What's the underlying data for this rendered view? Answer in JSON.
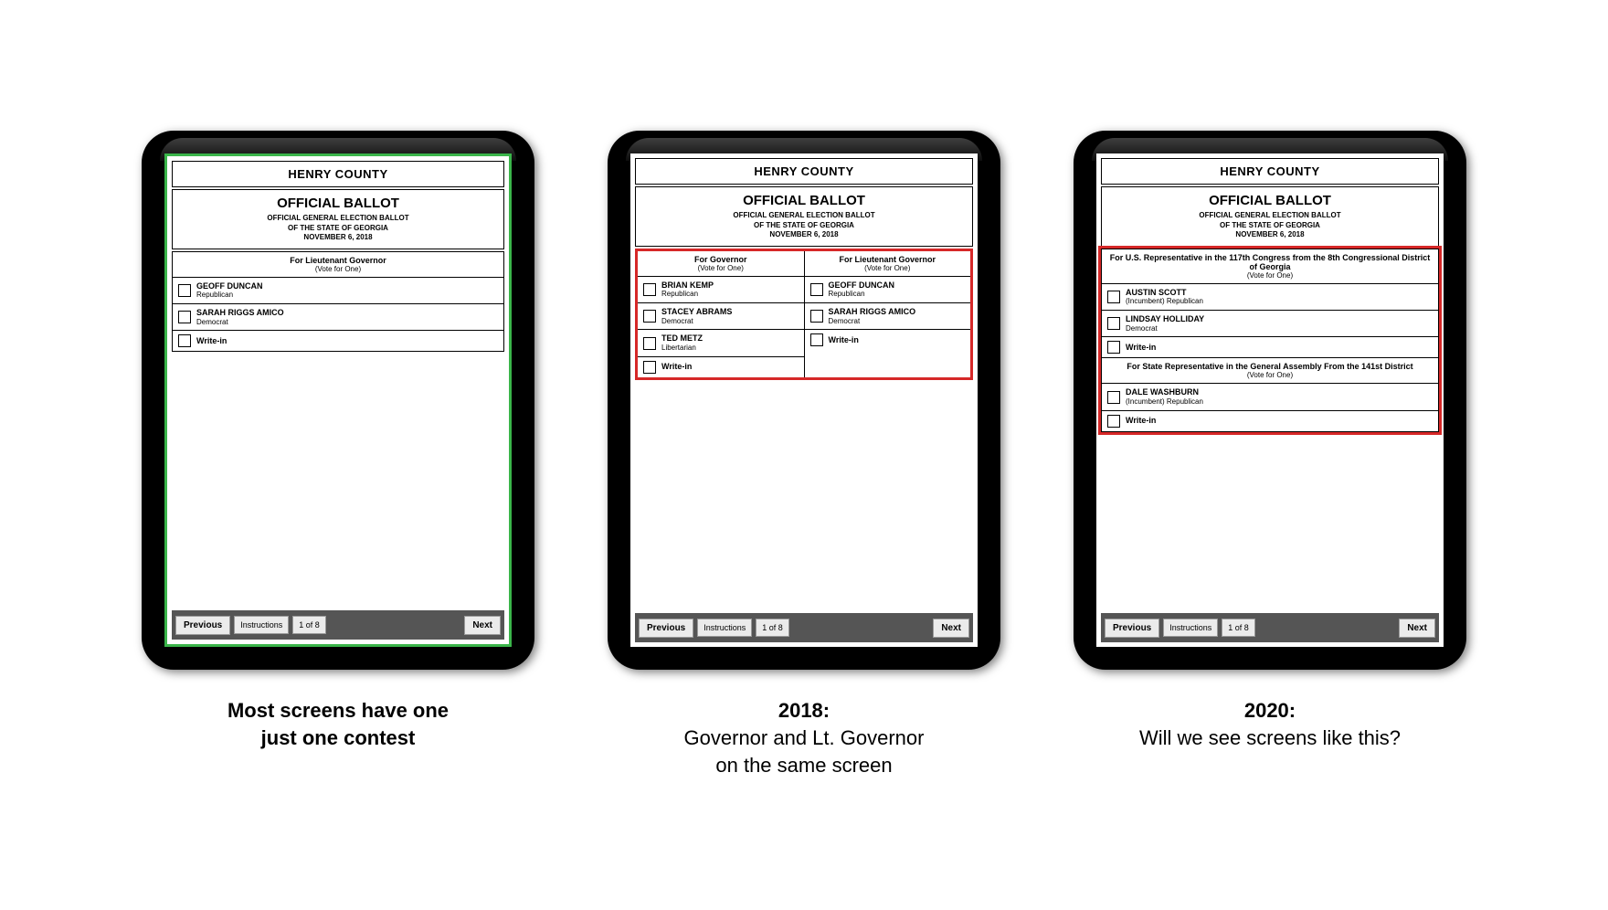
{
  "county": "HENRY COUNTY",
  "ballot_title": "OFFICIAL BALLOT",
  "ballot_sub1": "OFFICIAL GENERAL ELECTION BALLOT",
  "ballot_sub2": "OF THE STATE OF GEORGIA",
  "ballot_sub3": "NOVEMBER 6, 2018",
  "nav": {
    "prev": "Previous",
    "instr": "Instructions",
    "page": "1 of 8",
    "next": "Next"
  },
  "vote_for_one": "(Vote for One)",
  "write_in": "Write-in",
  "tablets": {
    "left": {
      "race": "For Lieutenant Governor",
      "candidates": [
        {
          "name": "GEOFF DUNCAN",
          "party": "Republican"
        },
        {
          "name": "SARAH RIGGS AMICO",
          "party": "Democrat"
        }
      ]
    },
    "middle": {
      "left_race": "For Governor",
      "left_candidates": [
        {
          "name": "BRIAN KEMP",
          "party": "Republican"
        },
        {
          "name": "STACEY ABRAMS",
          "party": "Democrat"
        },
        {
          "name": "TED METZ",
          "party": "Libertarian"
        }
      ],
      "right_race": "For Lieutenant Governor",
      "right_candidates": [
        {
          "name": "GEOFF DUNCAN",
          "party": "Republican"
        },
        {
          "name": "SARAH RIGGS AMICO",
          "party": "Democrat"
        }
      ]
    },
    "right": {
      "race1": "For U.S. Representative in the 117th Congress from the 8th Congressional District of Georgia",
      "race1_candidates": [
        {
          "name": "AUSTIN SCOTT",
          "party": "(Incumbent) Republican"
        },
        {
          "name": "LINDSAY HOLLIDAY",
          "party": "Democrat"
        }
      ],
      "race2": "For State Representative in the General Assembly From the 141st District",
      "race2_candidates": [
        {
          "name": "DALE WASHBURN",
          "party": "(Incumbent) Republican"
        }
      ]
    }
  },
  "captions": {
    "left_bold1": "Most screens have one",
    "left_bold2": "just one contest",
    "mid_bold": "2018:",
    "mid_l1": "Governor and Lt. Governor",
    "mid_l2": "on the same screen",
    "right_bold": "2020:",
    "right_l1": "Will we see screens like this?"
  }
}
